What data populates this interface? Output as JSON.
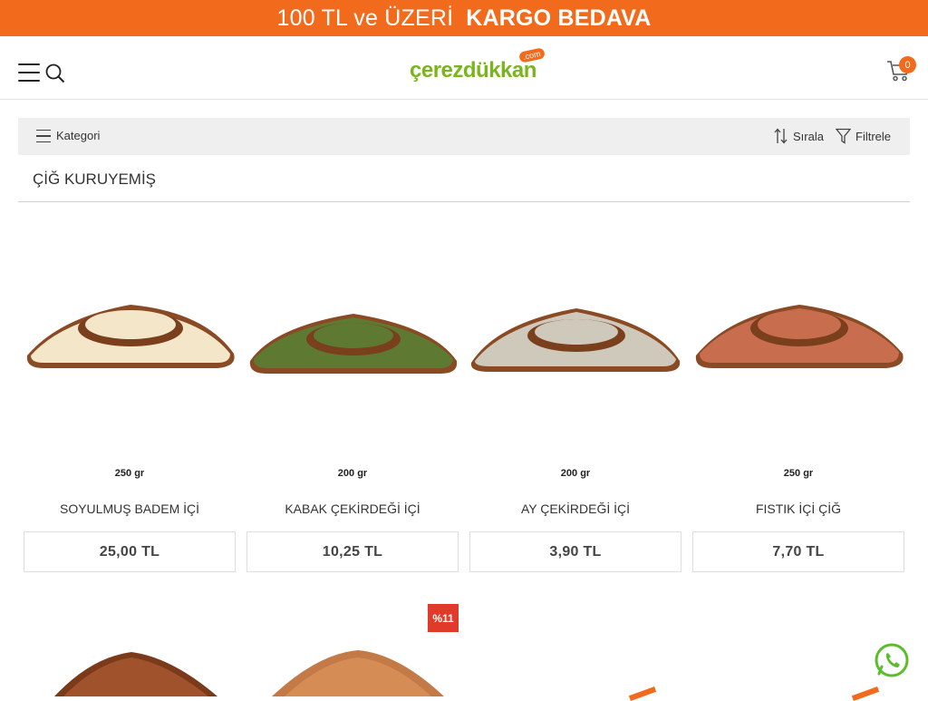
{
  "promo": {
    "part_a": "100 TL ve ÜZERİ",
    "part_b": "KARGO BEDAVA",
    "bg_color": "#f26b1d"
  },
  "header": {
    "logo_text": "çerezdükkan",
    "logo_com": ".com",
    "cart_count": "0"
  },
  "toolbar": {
    "category_label": "Kategori",
    "sort_label": "Sırala",
    "filter_label": "Filtrele"
  },
  "category": {
    "title": "ÇİĞ KURUYEMİŞ"
  },
  "products": [
    {
      "weight": "250 gr",
      "name": "SOYULMUŞ BADEM İÇİ",
      "price": "25,00 TL",
      "nut_color": "#f3e6c9"
    },
    {
      "weight": "200 gr",
      "name": "KABAK ÇEKİRDEĞİ İÇİ",
      "price": "10,25 TL",
      "nut_color": "#5e7a32"
    },
    {
      "weight": "200 gr",
      "name": "AY ÇEKİRDEĞİ İÇİ",
      "price": "3,90 TL",
      "nut_color": "#cfc9bb"
    },
    {
      "weight": "250 gr",
      "name": "FISTIK İÇİ ÇİĞ",
      "price": "7,70 TL",
      "nut_color": "#c86e4e"
    }
  ],
  "second_row": {
    "discount_badge": "%11"
  },
  "colors": {
    "accent": "#f26b1d",
    "logo_green": "#7ab51d",
    "discount_red": "#e03a2a",
    "whatsapp_green": "#5bbd2b"
  }
}
